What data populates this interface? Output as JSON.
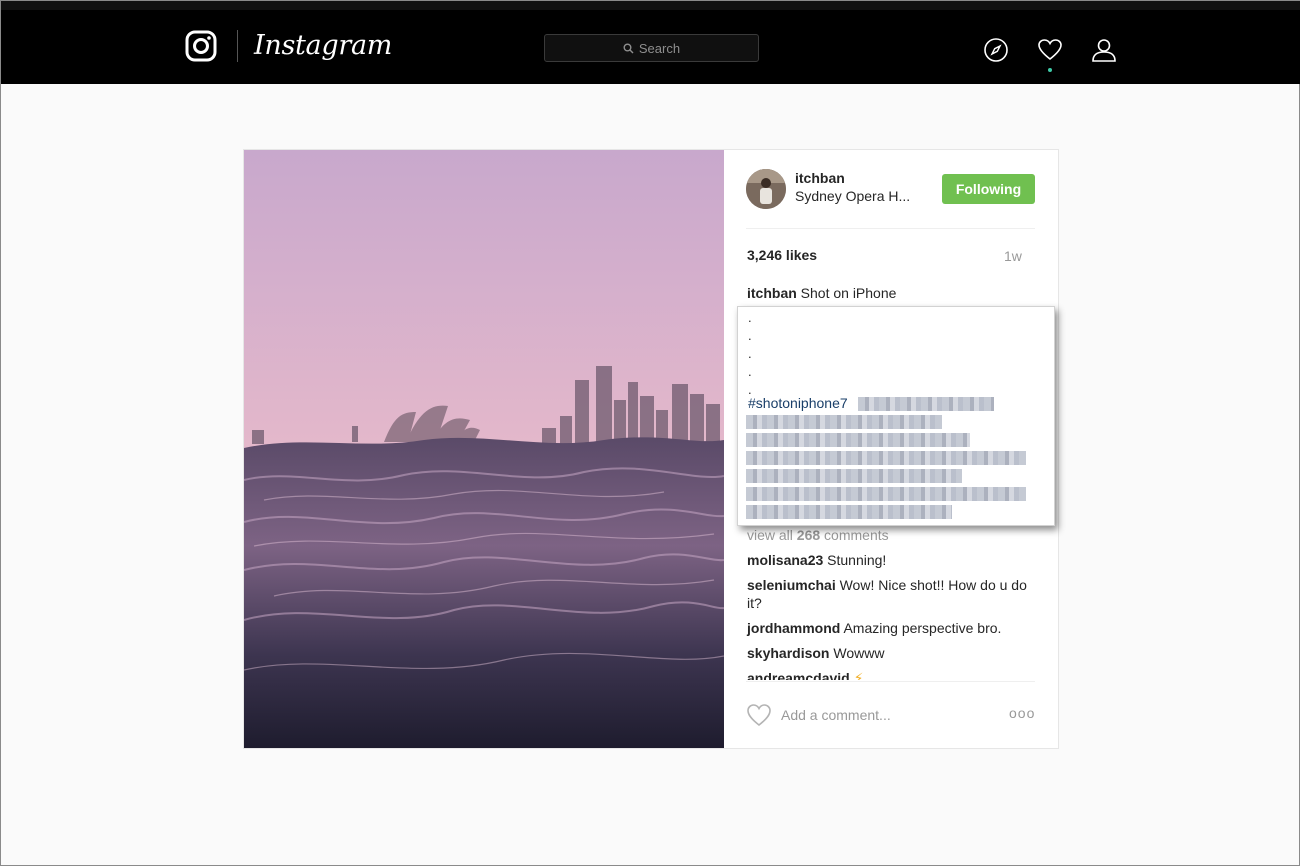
{
  "nav": {
    "brand": "Instagram",
    "search_placeholder": "Search",
    "icons": [
      "camera-icon",
      "compass-icon",
      "heart-icon",
      "profile-icon"
    ]
  },
  "post": {
    "username": "itchban",
    "location": "Sydney Opera H...",
    "follow_label": "Following",
    "likes": "3,246 likes",
    "age": "1w",
    "caption_user": "itchban",
    "caption_text": "Shot on iPhone",
    "caption_dots": [
      ".",
      ".",
      ".",
      ".",
      "."
    ],
    "hashtag": "#shotoniphone7",
    "view_all": {
      "prefix": "view all",
      "count": "268",
      "suffix": "comments"
    },
    "comments": [
      {
        "user": "molisana23",
        "text": "Stunning!"
      },
      {
        "user": "seleniumchai",
        "text": "Wow! Nice shot!! How do u do it?"
      },
      {
        "user": "jordhammond",
        "text": "Amazing perspective bro."
      },
      {
        "user": "skyhardison",
        "text": "Wowww"
      },
      {
        "user": "andreamcdavid",
        "text": "⚡"
      }
    ],
    "add_comment_placeholder": "Add a comment...",
    "more_label": "ooo"
  },
  "colors": {
    "nav_bg": "#000000",
    "follow_green": "#70c050",
    "hashtag_blue": "#1a3f69",
    "notification_dot": "#3ec9a7"
  }
}
